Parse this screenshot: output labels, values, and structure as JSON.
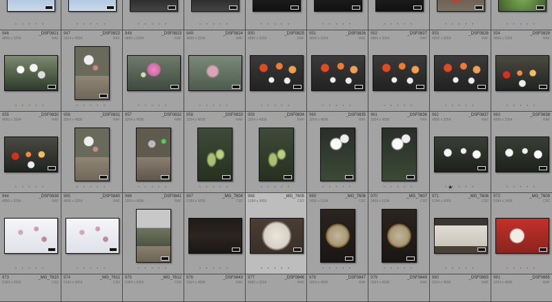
{
  "grid": {
    "top_row": {
      "cells": [
        {
          "thumb": "t-top-blue"
        },
        {
          "thumb": "t-top-blue"
        },
        {
          "thumb": "t-top-room"
        },
        {
          "thumb": "t-top-room"
        },
        {
          "thumb": "t-top-dark"
        },
        {
          "thumb": "t-top-dark"
        },
        {
          "thumb": "t-top-dark"
        },
        {
          "thumb": "t-top-tulips"
        },
        {
          "thumb": "t-top-green"
        }
      ]
    },
    "rows": [
      {
        "cells": [
          {
            "num": "946",
            "file": "_DSF0821",
            "dims": "4896 x 3264",
            "ext": "RAF",
            "thumb": "t-white-bouquet",
            "orient": "land"
          },
          {
            "num": "947",
            "file": "_DSF0822",
            "dims": "3264 x 4896",
            "ext": "RAF",
            "thumb": "t-planter",
            "orient": "port"
          },
          {
            "num": "948",
            "file": "_DSF0823",
            "dims": "4896 x 3264",
            "ext": "RAF",
            "thumb": "t-pink-hydrangea",
            "orient": "land"
          },
          {
            "num": "949",
            "file": "_DSF0824",
            "dims": "4896 x 3264",
            "ext": "RAF",
            "thumb": "t-pink-soft",
            "orient": "land"
          },
          {
            "num": "950",
            "file": "_DSF0825",
            "dims": "4896 x 3264",
            "ext": "RAF",
            "thumb": "t-tulips",
            "orient": "land"
          },
          {
            "num": "951",
            "file": "_DSF0826",
            "dims": "4896 x 3264",
            "ext": "RAF",
            "thumb": "t-tulips",
            "orient": "land"
          },
          {
            "num": "952",
            "file": "_DSF0827",
            "dims": "4896 x 3264",
            "ext": "RAF",
            "thumb": "t-tulips",
            "orient": "land"
          },
          {
            "num": "953",
            "file": "_DSF0828",
            "dims": "4896 x 3264",
            "ext": "RAF",
            "thumb": "t-tulips",
            "orient": "land"
          },
          {
            "num": "954",
            "file": "_DSF0829",
            "dims": "4896 x 3264",
            "ext": "RAF",
            "thumb": "t-tulips-low",
            "orient": "land"
          }
        ]
      },
      {
        "cells": [
          {
            "num": "955",
            "file": "_DSF0830",
            "dims": "4896 x 3264",
            "ext": "RAF",
            "thumb": "t-tulips-low",
            "orient": "land"
          },
          {
            "num": "956",
            "file": "_DSF0831",
            "dims": "3264 x 4896",
            "ext": "RAF",
            "thumb": "t-planter",
            "orient": "port"
          },
          {
            "num": "957",
            "file": "_DSF0832",
            "dims": "3264 x 4896",
            "ext": "RAF",
            "thumb": "t-planter-green",
            "orient": "port"
          },
          {
            "num": "958",
            "file": "_DSF0833",
            "dims": "3264 x 4896",
            "ext": "RAF",
            "thumb": "t-stems",
            "orient": "port"
          },
          {
            "num": "959",
            "file": "_DSF0834",
            "dims": "3264 x 4896",
            "ext": "RAF",
            "thumb": "t-stems",
            "orient": "port"
          },
          {
            "num": "960",
            "file": "_DSF0835",
            "dims": "3264 x 4896",
            "ext": "RAF",
            "thumb": "t-white-tall",
            "orient": "port"
          },
          {
            "num": "961",
            "file": "_DSF0836",
            "dims": "3264 x 4896",
            "ext": "RAF",
            "thumb": "t-white-tall",
            "orient": "port"
          },
          {
            "num": "962",
            "file": "_DSF0837",
            "dims": "4896 x 3264",
            "ext": "RAF",
            "thumb": "t-white-bed",
            "orient": "land",
            "star": true
          },
          {
            "num": "963",
            "file": "_DSF0838",
            "dims": "4896 x 3264",
            "ext": "RAF",
            "thumb": "t-white-bed",
            "orient": "land"
          }
        ]
      },
      {
        "cells": [
          {
            "num": "964",
            "file": "_DSF0839",
            "dims": "4896 x 3264",
            "ext": "RAF",
            "thumb": "t-magnolia",
            "orient": "land"
          },
          {
            "num": "965",
            "file": "_DSF0840",
            "dims": "4896 x 3264",
            "ext": "RAF",
            "thumb": "t-magnolia",
            "orient": "land"
          },
          {
            "num": "966",
            "file": "_DSF0841",
            "dims": "3264 x 4896",
            "ext": "RAF",
            "thumb": "t-street",
            "orient": "port"
          },
          {
            "num": "967",
            "file": "_MG_7604",
            "dims": "5184 x 3456",
            "ext": "CR2",
            "thumb": "t-dark-room",
            "orient": "land"
          },
          {
            "num": "968",
            "file": "_MG_7605",
            "dims": "5184 x 3456",
            "ext": "CR2",
            "thumb": "t-painting-white",
            "orient": "land",
            "selected": true
          },
          {
            "num": "969",
            "file": "_MG_7606",
            "dims": "3456 x 5184",
            "ext": "CR2",
            "thumb": "t-painting-frame",
            "orient": "port"
          },
          {
            "num": "970",
            "file": "_MG_7607",
            "dims": "3456 x 5184",
            "ext": "CR2",
            "thumb": "t-painting-frame",
            "orient": "port"
          },
          {
            "num": "971",
            "file": "_MG_7608",
            "dims": "5184 x 3456",
            "ext": "CR2",
            "thumb": "t-gallery",
            "orient": "land"
          },
          {
            "num": "972",
            "file": "_MG_7609",
            "dims": "5184 x 3456",
            "ext": "CR2",
            "thumb": "t-red-painting",
            "orient": "land"
          }
        ]
      }
    ],
    "bottom_row": {
      "cells": [
        {
          "num": "973",
          "file": "_MG_7610",
          "dims": "5184 x 3456",
          "ext": "CR2"
        },
        {
          "num": "974",
          "file": "_MG_7611",
          "dims": "5184 x 3456",
          "ext": "CR2"
        },
        {
          "num": "975",
          "file": "_MG_7612",
          "dims": "5184 x 3456",
          "ext": "CR2"
        },
        {
          "num": "976",
          "file": "_DSF0843",
          "dims": "3264 x 4896",
          "ext": "RAF"
        },
        {
          "num": "977",
          "file": "_DSF0846",
          "dims": "4896 x 3264",
          "ext": "RAF"
        },
        {
          "num": "978",
          "file": "_DSF0847",
          "dims": "3264 x 4896",
          "ext": "RAF"
        },
        {
          "num": "979",
          "file": "_DSF0849",
          "dims": "3264 x 4896",
          "ext": "RAF"
        },
        {
          "num": "980",
          "file": "_DSF0863",
          "dims": "3264 x 4896",
          "ext": "RAF"
        },
        {
          "num": "981",
          "file": "_DSF0865",
          "dims": "3264 x 4896",
          "ext": "RAF"
        }
      ]
    },
    "rating_dots": "• • • • •",
    "star_glyph": "★",
    "accent_colors": {
      "cell_bg": "#a3a3a3",
      "selected_bg": "#bdbdbd",
      "gutter": "#4a4a4a"
    }
  }
}
